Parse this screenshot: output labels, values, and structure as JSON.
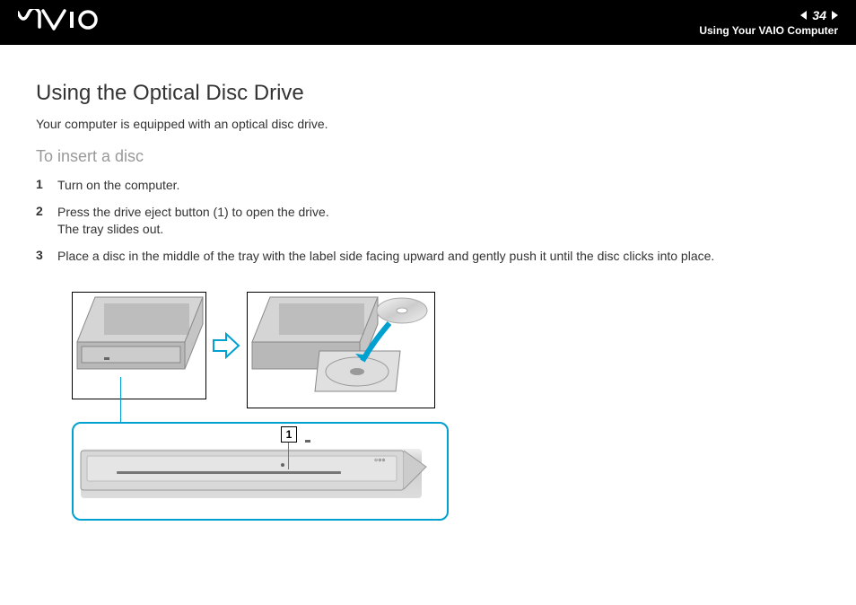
{
  "header": {
    "logo_text": "VAIO",
    "page_number": "34",
    "breadcrumb": "Using Your VAIO Computer"
  },
  "content": {
    "title": "Using the Optical Disc Drive",
    "intro": "Your computer is equipped with an optical disc drive.",
    "subtitle": "To insert a disc",
    "steps": [
      {
        "num": "1",
        "text": "Turn on the computer."
      },
      {
        "num": "2",
        "text": "Press the drive eject button (1) to open the drive.\nThe tray slides out."
      },
      {
        "num": "3",
        "text": "Place a disc in the middle of the tray with the label side facing upward and gently push it until the disc clicks into place."
      }
    ],
    "callout_label": "1"
  }
}
